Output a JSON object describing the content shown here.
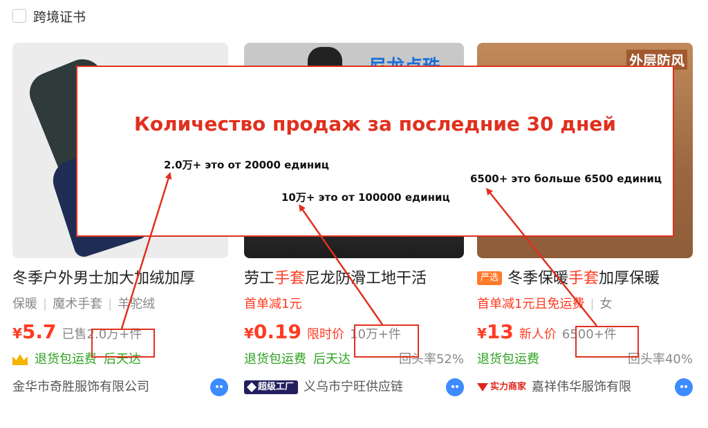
{
  "filter": {
    "label": "跨境证书"
  },
  "products": [
    {
      "title_parts": [
        "冬季户外男士加大加绒加厚"
      ],
      "tags": [
        "保暖",
        "魔术手套",
        "羊驼绒"
      ],
      "currency": "¥",
      "price": "5.7",
      "price_note": "",
      "sold_prefix": "已售",
      "sold": "2.0万+件",
      "services": [
        "退货包运费",
        "后天达"
      ],
      "return_rate": "",
      "shop_name": "金华市奇胜服饰有限公司"
    },
    {
      "title_parts": [
        "劳工",
        "手套",
        "尼龙防滑工地干活"
      ],
      "promo": "首单减1元",
      "currency": "¥",
      "price": "0.19",
      "price_note": "限时价",
      "sold": "10万+件",
      "services": [
        "退货包运费",
        "后天达"
      ],
      "return_rate": "回头率52%",
      "shop_badge": "超级工厂",
      "shop_name": "义乌市宁旺供应链",
      "image_text": "尼龙点珠"
    },
    {
      "badge": "严选",
      "title_parts": [
        "冬季保暖",
        "手套",
        "加厚保暖"
      ],
      "promo": "首单减1元且免运费",
      "promo_tag": "女",
      "currency": "¥",
      "price": "13",
      "price_note": "新人价",
      "sold": "6500+件",
      "services": [
        "退货包运费"
      ],
      "return_rate": "回头率40%",
      "shop_badge": "实力商家",
      "shop_name": "嘉祥伟华服饰有限",
      "image_text": "外层防风"
    }
  ],
  "annotation": {
    "title": "Количество продаж за последние 30 дней",
    "note_1": "2.0万+ это от 20000 единиц",
    "note_2": "10万+ это от 100000 единиц",
    "note_3": "6500+ это больше 6500 единиц"
  },
  "colors": {
    "accent_red": "#ff3b22",
    "annotation_red": "#e0301e",
    "service_green": "#2ea121",
    "chat_blue": "#3d8bff"
  }
}
